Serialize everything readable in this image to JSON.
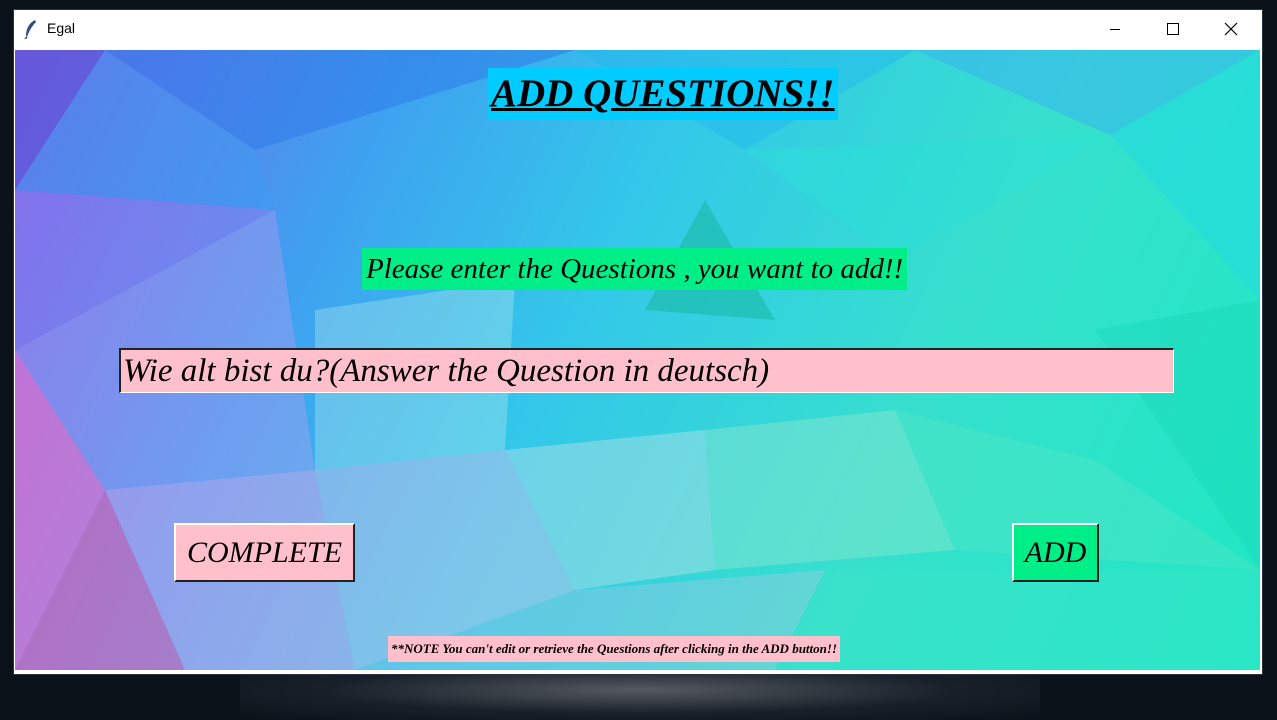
{
  "window": {
    "title": "Egal",
    "icon": "feather-icon",
    "controls": [
      "minimize-icon",
      "maximize-icon",
      "close-icon"
    ]
  },
  "main": {
    "heading": "ADD QUESTIONS!!",
    "prompt": "Please enter the Questions , you want to add!!",
    "question_input_value": "Wie alt bist du?(Answer the Question in deutsch)",
    "complete_label": "COMPLETE",
    "add_label": "ADD",
    "note": "**NOTE You can't edit or retrieve the Questions after clicking in the ADD button!!"
  },
  "colors": {
    "heading_bg": "#00ccff",
    "prompt_bg": "#00ee88",
    "input_bg": "#ffc0cb",
    "complete_bg": "#ffc0cb",
    "add_bg": "#00ee88",
    "note_bg": "#ffc0cb"
  }
}
